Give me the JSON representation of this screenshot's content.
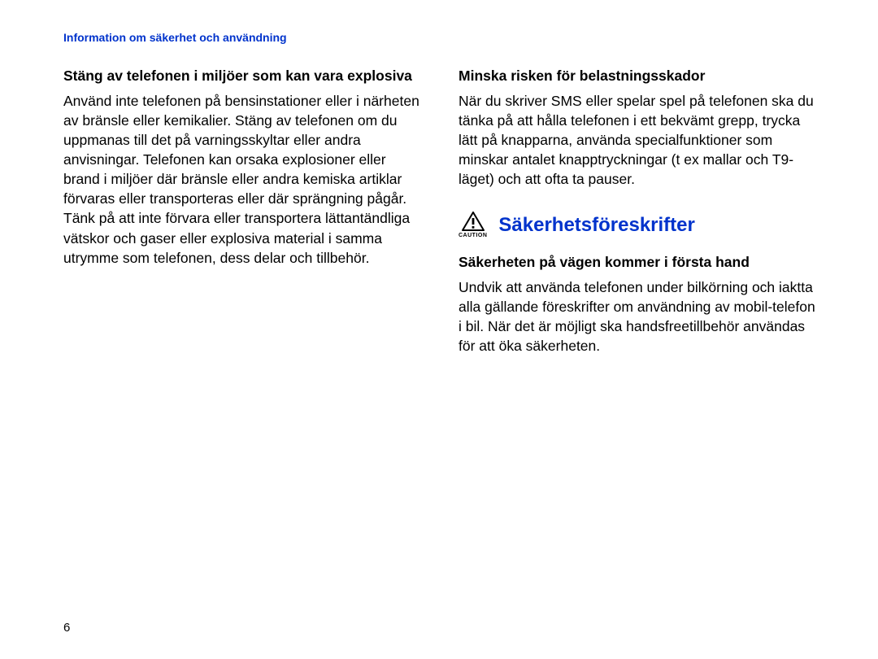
{
  "header": "Information om säkerhet och användning",
  "left": {
    "h1": "Stäng av telefonen i miljöer som kan vara explosiva",
    "p1": "Använd inte telefonen på bensinstationer eller i närheten av bränsle eller kemikalier. Stäng av telefonen om du uppmanas till det på varningsskyltar eller andra anvisningar. Telefonen kan orsaka explosioner eller brand i miljöer där bränsle eller andra kemiska artiklar förvaras eller transporteras eller där sprängning pågår. Tänk på att inte förvara eller transportera lättantändliga vätskor och gaser eller explosiva material i samma utrymme som telefonen, dess delar och tillbehör."
  },
  "right": {
    "h1": "Minska risken för belastningsskador",
    "p1": "När du skriver SMS eller spelar spel på telefonen ska du tänka på att hålla telefonen i ett bekvämt grepp, trycka lätt på knapparna, använda specialfunktioner som minskar antalet knapptryckningar (t ex mallar och T9-läget) och att ofta ta pauser.",
    "caution_label": "CAUTION",
    "section_title": "Säkerhetsföreskrifter",
    "h2": "Säkerheten på vägen kommer i första hand",
    "p2": "Undvik att använda telefonen under bilkörning och iaktta alla gällande föreskrifter om användning av mobil-telefon i bil. När det är möjligt ska handsfreetillbehör användas för att öka säkerheten."
  },
  "page_number": "6"
}
